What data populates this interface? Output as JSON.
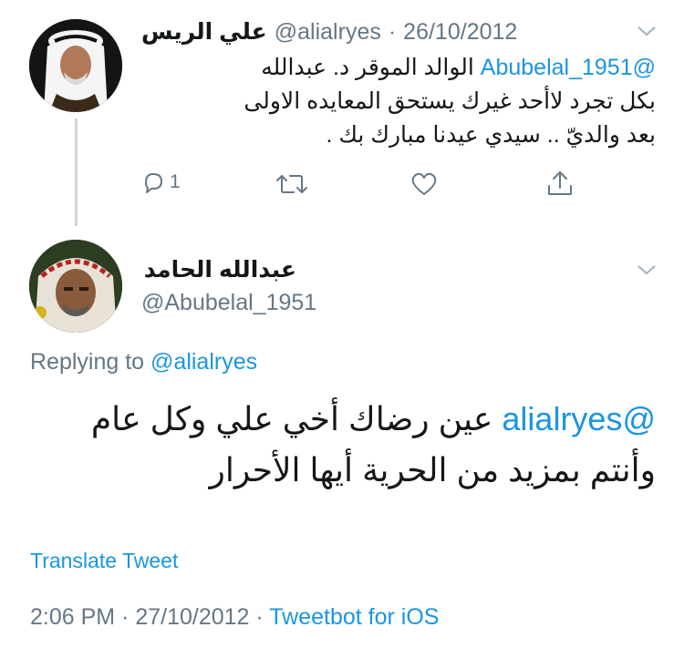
{
  "parent_tweet": {
    "display_name": "علي الريس",
    "handle": "@alialryes",
    "separator": "·",
    "date": "26/10/2012",
    "text_line1": "@Abubelal_1951 الوالد الموقر د. عبدالله",
    "text_line2": "بكل تجرد لاأحد غيرك يستحق المعايده الاولى",
    "text_line3": "بعد والديّ .. سيدي عيدنا مبارك بك .",
    "reply_count": "1",
    "icons": [
      "reply-icon",
      "retweet-icon",
      "like-icon",
      "share-icon",
      "chevron-down-icon"
    ]
  },
  "main_tweet": {
    "display_name": "عبدالله الحامد",
    "handle": "@Abubelal_1951",
    "replying_prefix": "Replying to",
    "replying_handle": "@alialryes",
    "text_line1": "@alialryes  عين رضاك أخي علي وكل عام",
    "text_line2": "وأنتم بمزيد من الحرية أيها الأحرار",
    "translate_label": "Translate Tweet",
    "time": "2:06 PM",
    "separator": "·",
    "date": "27/10/2012",
    "separator2": "·",
    "client": "Tweetbot for iOS"
  },
  "colors": {
    "link": "#1b95e0",
    "muted": "#657786",
    "text": "#14171a",
    "thread_line": "#ccd6dd"
  }
}
